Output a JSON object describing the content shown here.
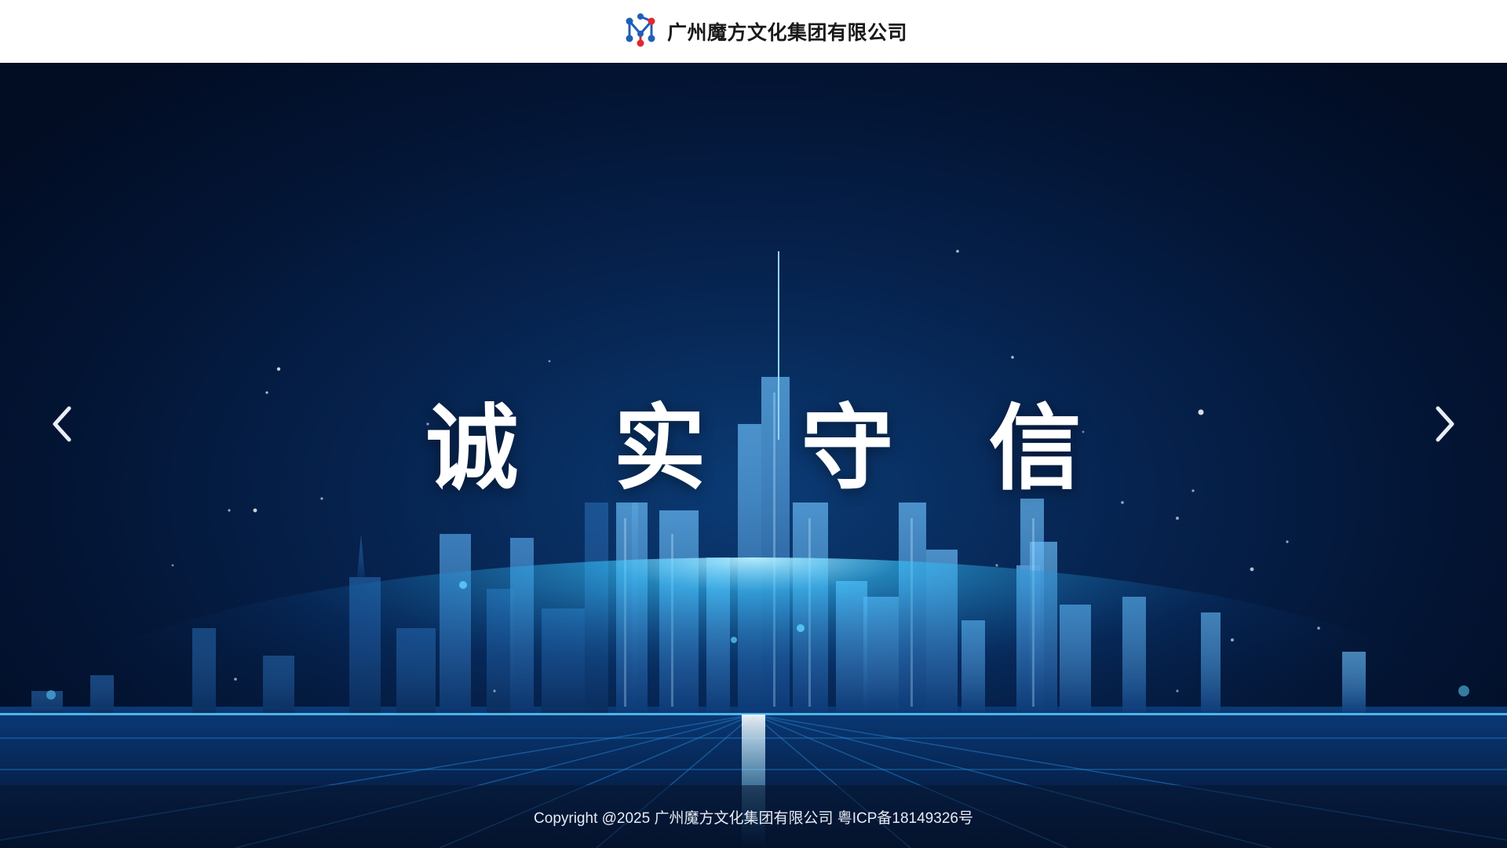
{
  "header": {
    "company_name": "广州魔方文化集团有限公司",
    "logo_icon": "molecule-logo-icon"
  },
  "hero": {
    "slogan": "诚 实 守 信",
    "prev_icon": "chevron-left-icon",
    "next_icon": "chevron-right-icon"
  },
  "footer": {
    "copyright": "Copyright @2025 广州魔方文化集团有限公司 粤ICP备18149326号"
  },
  "colors": {
    "logo_blue": "#1f5fb8",
    "logo_red": "#e3262f",
    "hero_dark": "#031433",
    "hero_glow": "#37c6ff"
  }
}
